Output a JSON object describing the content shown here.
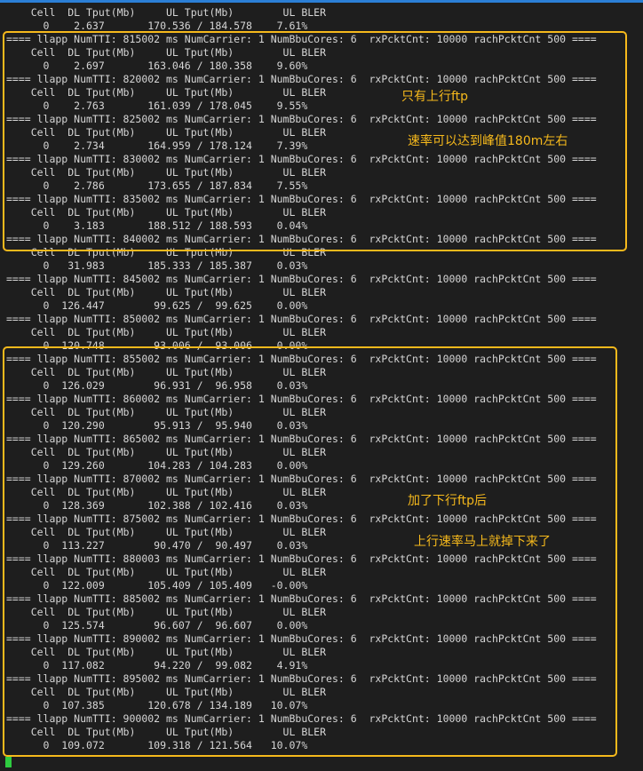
{
  "terminal": {
    "lines": [
      "    Cell  DL Tput(Mb)     UL Tput(Mb)        UL BLER",
      "      0    2.637       170.536 / 184.578    7.61%",
      "==== llapp NumTTI: 815002 ms NumCarrier: 1 NumBbuCores: 6  rxPcktCnt: 10000 rachPcktCnt 500 ====",
      "    Cell  DL Tput(Mb)     UL Tput(Mb)        UL BLER",
      "      0    2.697       163.046 / 180.358    9.60%",
      "==== llapp NumTTI: 820002 ms NumCarrier: 1 NumBbuCores: 6  rxPcktCnt: 10000 rachPcktCnt 500 ====",
      "    Cell  DL Tput(Mb)     UL Tput(Mb)        UL BLER",
      "      0    2.763       161.039 / 178.045    9.55%",
      "==== llapp NumTTI: 825002 ms NumCarrier: 1 NumBbuCores: 6  rxPcktCnt: 10000 rachPcktCnt 500 ====",
      "    Cell  DL Tput(Mb)     UL Tput(Mb)        UL BLER",
      "      0    2.734       164.959 / 178.124    7.39%",
      "==== llapp NumTTI: 830002 ms NumCarrier: 1 NumBbuCores: 6  rxPcktCnt: 10000 rachPcktCnt 500 ====",
      "    Cell  DL Tput(Mb)     UL Tput(Mb)        UL BLER",
      "      0    2.786       173.655 / 187.834    7.55%",
      "==== llapp NumTTI: 835002 ms NumCarrier: 1 NumBbuCores: 6  rxPcktCnt: 10000 rachPcktCnt 500 ====",
      "    Cell  DL Tput(Mb)     UL Tput(Mb)        UL BLER",
      "      0    3.183       188.512 / 188.593    0.04%",
      "==== llapp NumTTI: 840002 ms NumCarrier: 1 NumBbuCores: 6  rxPcktCnt: 10000 rachPcktCnt 500 ====",
      "    Cell  DL Tput(Mb)     UL Tput(Mb)        UL BLER",
      "      0   31.983       185.333 / 185.387    0.03%",
      "==== llapp NumTTI: 845002 ms NumCarrier: 1 NumBbuCores: 6  rxPcktCnt: 10000 rachPcktCnt 500 ====",
      "    Cell  DL Tput(Mb)     UL Tput(Mb)        UL BLER",
      "      0  126.447        99.625 /  99.625    0.00%",
      "==== llapp NumTTI: 850002 ms NumCarrier: 1 NumBbuCores: 6  rxPcktCnt: 10000 rachPcktCnt 500 ====",
      "    Cell  DL Tput(Mb)     UL Tput(Mb)        UL BLER",
      "      0  120.748        93.006 /  93.006    0.00%",
      "==== llapp NumTTI: 855002 ms NumCarrier: 1 NumBbuCores: 6  rxPcktCnt: 10000 rachPcktCnt 500 ====",
      "    Cell  DL Tput(Mb)     UL Tput(Mb)        UL BLER",
      "      0  126.029        96.931 /  96.958    0.03%",
      "==== llapp NumTTI: 860002 ms NumCarrier: 1 NumBbuCores: 6  rxPcktCnt: 10000 rachPcktCnt 500 ====",
      "    Cell  DL Tput(Mb)     UL Tput(Mb)        UL BLER",
      "      0  120.290        95.913 /  95.940    0.03%",
      "==== llapp NumTTI: 865002 ms NumCarrier: 1 NumBbuCores: 6  rxPcktCnt: 10000 rachPcktCnt 500 ====",
      "    Cell  DL Tput(Mb)     UL Tput(Mb)        UL BLER",
      "      0  129.260       104.283 / 104.283    0.00%",
      "==== llapp NumTTI: 870002 ms NumCarrier: 1 NumBbuCores: 6  rxPcktCnt: 10000 rachPcktCnt 500 ====",
      "    Cell  DL Tput(Mb)     UL Tput(Mb)        UL BLER",
      "      0  128.369       102.388 / 102.416    0.03%",
      "==== llapp NumTTI: 875002 ms NumCarrier: 1 NumBbuCores: 6  rxPcktCnt: 10000 rachPcktCnt 500 ====",
      "    Cell  DL Tput(Mb)     UL Tput(Mb)        UL BLER",
      "      0  113.227        90.470 /  90.497    0.03%",
      "==== llapp NumTTI: 880003 ms NumCarrier: 1 NumBbuCores: 6  rxPcktCnt: 10000 rachPcktCnt 500 ====",
      "    Cell  DL Tput(Mb)     UL Tput(Mb)        UL BLER",
      "      0  122.009       105.409 / 105.409   -0.00%",
      "==== llapp NumTTI: 885002 ms NumCarrier: 1 NumBbuCores: 6  rxPcktCnt: 10000 rachPcktCnt 500 ====",
      "    Cell  DL Tput(Mb)     UL Tput(Mb)        UL BLER",
      "      0  125.574        96.607 /  96.607    0.00%",
      "==== llapp NumTTI: 890002 ms NumCarrier: 1 NumBbuCores: 6  rxPcktCnt: 10000 rachPcktCnt 500 ====",
      "    Cell  DL Tput(Mb)     UL Tput(Mb)        UL BLER",
      "      0  117.082        94.220 /  99.082    4.91%",
      "==== llapp NumTTI: 895002 ms NumCarrier: 1 NumBbuCores: 6  rxPcktCnt: 10000 rachPcktCnt 500 ====",
      "    Cell  DL Tput(Mb)     UL Tput(Mb)        UL BLER",
      "      0  107.385       120.678 / 134.189   10.07%",
      "==== llapp NumTTI: 900002 ms NumCarrier: 1 NumBbuCores: 6  rxPcktCnt: 10000 rachPcktCnt 500 ====",
      "    Cell  DL Tput(Mb)     UL Tput(Mb)        UL BLER",
      "      0  109.072       109.318 / 121.564   10.07%"
    ]
  },
  "annotations": {
    "upload_only": "只有上行ftp",
    "peak_rate": "速率可以达到峰值180m左右",
    "added_download": "加了下行ftp后",
    "upload_dropped": "上行速率马上就掉下来了"
  },
  "colors": {
    "background": "#1e1e1e",
    "text": "#d6d6d6",
    "highlight": "#f6b91c",
    "cursor": "#2ecc40",
    "title_bar": "#2b7fd6"
  }
}
